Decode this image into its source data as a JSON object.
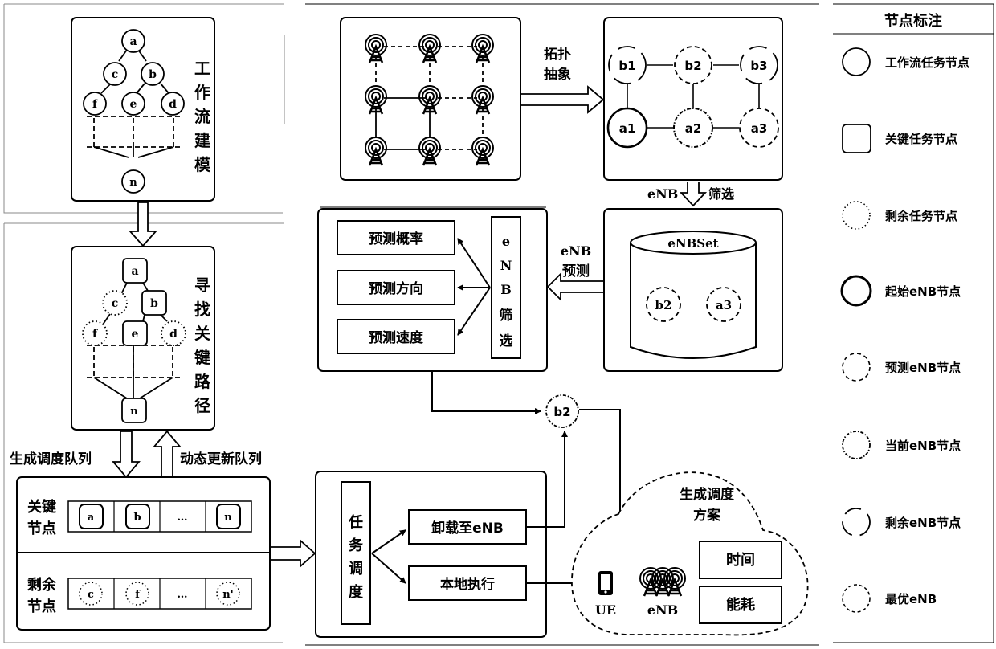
{
  "workflow_modeling": {
    "title_chars": [
      "工",
      "作",
      "流",
      "建",
      "模"
    ],
    "nodes": [
      "a",
      "c",
      "b",
      "f",
      "e",
      "d",
      "n"
    ]
  },
  "critical_path": {
    "title_chars": [
      "寻",
      "找",
      "关",
      "键",
      "路",
      "径"
    ],
    "nodes": [
      "a",
      "c",
      "b",
      "f",
      "e",
      "d",
      "n"
    ]
  },
  "arrows": {
    "generate_queue": "生成调度队列",
    "dynamic_update": "动态更新队列",
    "topology_line1": "拓扑",
    "topology_line2": "抽象",
    "enb_filter_left": "eNB",
    "enb_filter_right": "筛选",
    "enb_predict_line1": "eNB",
    "enb_predict_line2": "预测"
  },
  "queue": {
    "critical_label": [
      "关键",
      "节点"
    ],
    "critical_cells": [
      "a",
      "b",
      "…",
      "n"
    ],
    "remaining_label": [
      "剩余",
      "节点"
    ],
    "remaining_cells": [
      "c",
      "f",
      "…",
      "n'"
    ]
  },
  "topology": {
    "nodes": [
      "b1",
      "b2",
      "b3",
      "a1",
      "a2",
      "a3"
    ]
  },
  "enbset": {
    "title": "eNBSet",
    "nodes": [
      "b2",
      "a3"
    ]
  },
  "prediction": {
    "items": [
      "预测概率",
      "预测方向",
      "预测速度"
    ],
    "filter_chars": [
      "e",
      "N",
      "B",
      "筛",
      "选"
    ]
  },
  "scheduling": {
    "title_chars": [
      "任",
      "务",
      "调",
      "度"
    ],
    "offload": "卸载至eNB",
    "local": "本地执行",
    "selected_node": "b2"
  },
  "plan": {
    "title_line1": "生成调度",
    "title_line2": "方案",
    "ue_label": "UE",
    "enb_label": "eNB",
    "metrics": [
      "时间",
      "能耗"
    ]
  },
  "legend": {
    "title": "节点标注",
    "items": [
      {
        "label": "工作流任务节点",
        "style": "solid"
      },
      {
        "label": "关键任务节点",
        "style": "rounded-square"
      },
      {
        "label": "剩余任务节点",
        "style": "dotted"
      },
      {
        "label": "起始eNB节点",
        "style": "bold"
      },
      {
        "label": "预测eNB节点",
        "style": "dashed"
      },
      {
        "label": "当前eNB节点",
        "style": "dash-dot"
      },
      {
        "label": "剩余eNB节点",
        "style": "broken"
      },
      {
        "label": "最优eNB",
        "style": "fine-dashed"
      }
    ]
  }
}
